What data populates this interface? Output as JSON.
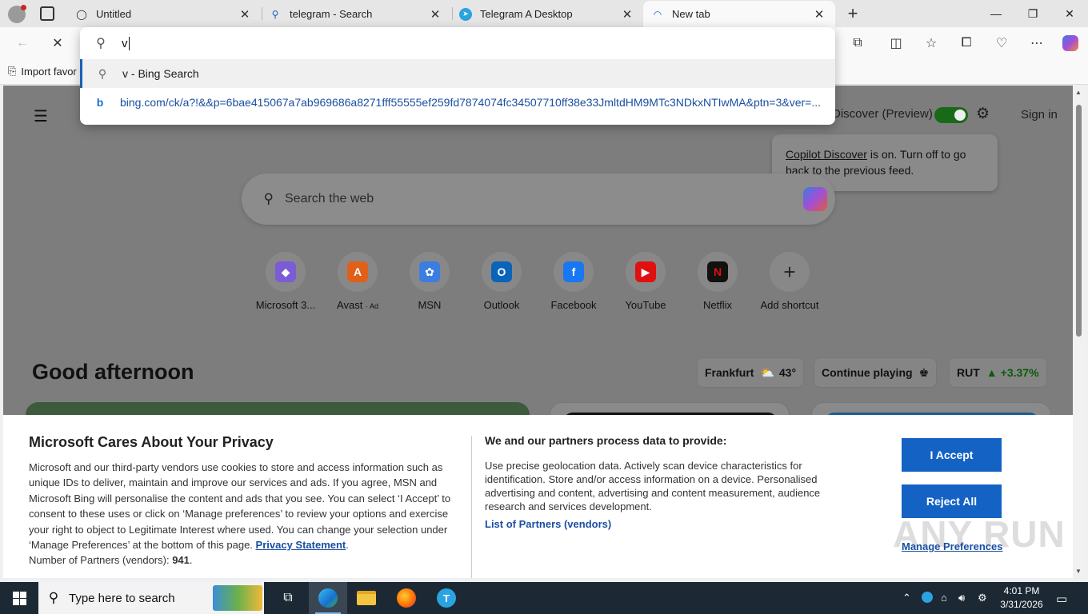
{
  "tabs": [
    {
      "title": "Untitled",
      "icon": "globe-icon"
    },
    {
      "title": "telegram - Search",
      "icon": "search-icon"
    },
    {
      "title": "Telegram A Desktop",
      "icon": "telegram-icon"
    },
    {
      "title": "New tab",
      "icon": "loading-icon"
    }
  ],
  "address": {
    "typed": "v",
    "suggestions": [
      {
        "text": "v - Bing Search",
        "icon": "search-icon"
      },
      {
        "text": "bing.com/ck/a?!&&p=6bae415067a7ab969686a8271fff55555ef259fd7874074fc34507710ff38e33JmltdHM9MTc3NDkxNTIwMA&ptn=3&ver=...",
        "icon": "bing-icon"
      }
    ]
  },
  "favorites": {
    "import_label": "Import favor"
  },
  "newtab": {
    "discover_label": "Discover (Preview)",
    "signin": "Sign in",
    "callout_link": "Copilot Discover",
    "callout_text": " is on. Turn off to go back to the previous feed.",
    "search_placeholder": "Search the web",
    "shortcuts": [
      {
        "label": "Microsoft 3...",
        "color": "#7b5cd6",
        "glyph": "◆"
      },
      {
        "label": "Avast",
        "ad": "· Ad",
        "color": "#e0601a",
        "glyph": "A"
      },
      {
        "label": "MSN",
        "color": "#3b7de0",
        "glyph": "✿"
      },
      {
        "label": "Outlook",
        "color": "#0a64b8",
        "glyph": "O"
      },
      {
        "label": "Facebook",
        "color": "#1877f2",
        "glyph": "f"
      },
      {
        "label": "YouTube",
        "color": "#e01010",
        "glyph": "▶"
      },
      {
        "label": "Netflix",
        "color": "#111111",
        "glyph": "N"
      },
      {
        "label": "Add shortcut",
        "color": "#888888",
        "glyph": "+"
      }
    ],
    "greeting": "Good afternoon",
    "weather": {
      "city": "Frankfurt",
      "temp": "43°"
    },
    "continue_playing": "Continue playing",
    "stock": {
      "symbol": "RUT",
      "change": "+3.37%"
    }
  },
  "privacy": {
    "heading": "Microsoft Cares About Your Privacy",
    "body": "Microsoft and our third-party vendors use cookies to store and access information such as unique IDs to deliver, maintain and improve our services and ads. If you agree, MSN and Microsoft Bing will personalise the content and ads that you see. You can select ‘I Accept’ to consent to these uses or click on ‘Manage preferences’ to review your options and exercise your right to object to Legitimate Interest where used.  You can change your selection under ‘Manage Preferences’ at the bottom of this page. ",
    "privacy_link": "Privacy Statement",
    "partners_label": "Number of Partners (vendors): ",
    "partners_count": "941",
    "heading2": "We and our partners process data to provide:",
    "body2": "Use precise geolocation data. Actively scan device characteristics for identification. Store and/or access information on a device. Personalised advertising and content, advertising and content measurement, audience research and services development.",
    "vendors_link": "List of Partners (vendors)",
    "accept": "I Accept",
    "reject": "Reject All",
    "manage": "Manage Preferences",
    "watermark": "ANY RUN"
  },
  "taskbar": {
    "search_placeholder": "Type here to search",
    "time": "4:01 PM",
    "date": "3/31/2026"
  }
}
